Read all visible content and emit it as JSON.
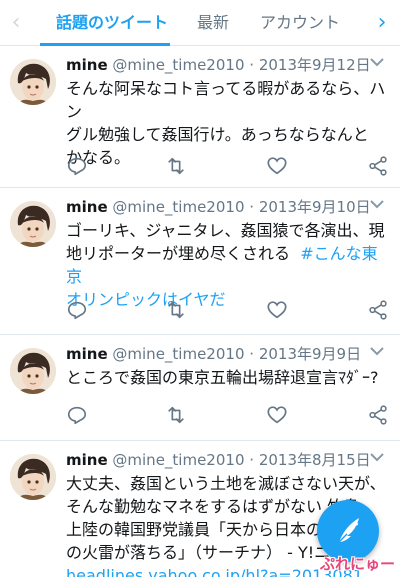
{
  "tabs": {
    "active": "話題のツイート",
    "second": "最新",
    "third": "アカウント"
  },
  "tweets": [
    {
      "name": "mine",
      "handle": "@mine_time2010",
      "date": "2013年9月12日",
      "lines": [
        "そんな阿呆なコト言ってる暇があるなら、ハン",
        "グル勉強して姦国行け。あっちならなんと",
        "かなる。"
      ]
    },
    {
      "name": "mine",
      "handle": "@mine_time2010",
      "date": "2013年9月10日",
      "line1": "ゴーリキ、ジャニタレ、姦国猿で各演出、現",
      "line2": "地リポーターが埋め尽くされる",
      "hashtag_a": "#こんな東京",
      "hashtag_b": "オリンピックはイヤだ"
    },
    {
      "name": "mine",
      "handle": "@mine_time2010",
      "date": "2013年9月9日",
      "lines": [
        "ところで姦国の東京五輪出場辞退宣言ﾏﾀﾞｰ?"
      ]
    },
    {
      "name": "mine",
      "handle": "@mine_time2010",
      "date": "2013年8月15日",
      "lines": [
        "大丈夫、姦国という土地を滅ぼさない天が、",
        "そんな勤勉なマネをするはずがない 竹島",
        "上陸の韓国野党議員「天から日本の地",
        "の火雷が落ちる」（サーチナ） - Y!ニ"
      ],
      "link": "headlines.yahoo.co.jp/hl?a=2013081..."
    }
  ],
  "dot": "·",
  "watermark": "ぷれにゅー",
  "colors": {
    "accent": "#1da1f2",
    "text": "#14171a",
    "muted": "#657786"
  }
}
